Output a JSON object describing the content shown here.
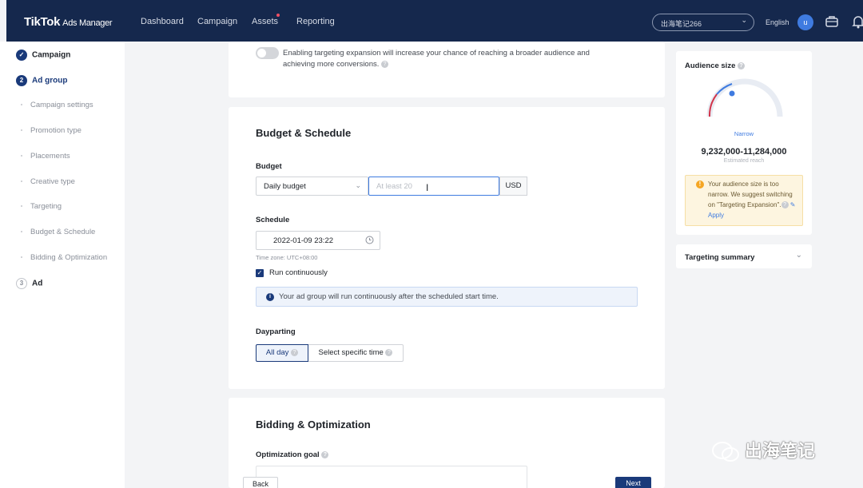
{
  "topbar": {
    "logo": "TikTok",
    "logo_sub": "Ads Manager",
    "nav": [
      "Dashboard",
      "Campaign",
      "Assets",
      "Reporting"
    ],
    "account": "出海笔记266",
    "language": "English",
    "avatar_letter": "u"
  },
  "sidebar": {
    "steps": [
      {
        "label": "Campaign",
        "state": "done"
      },
      {
        "label": "Ad group",
        "number": "2",
        "state": "active"
      },
      {
        "label": "Ad",
        "number": "3",
        "state": "pending"
      }
    ],
    "sub_items": [
      "Campaign settings",
      "Promotion type",
      "Placements",
      "Creative type",
      "Targeting",
      "Budget & Schedule",
      "Bidding & Optimization"
    ]
  },
  "expansion": {
    "text": "Enabling targeting expansion will increase your chance of reaching a broader audience and achieving more conversions."
  },
  "budget_schedule": {
    "title": "Budget & Schedule",
    "budget_label": "Budget",
    "budget_type": "Daily budget",
    "budget_placeholder": "At least 20",
    "currency": "USD",
    "schedule_label": "Schedule",
    "start_time": "2022-01-09 23:22",
    "timezone": "Time zone: UTC+08:00",
    "run_continuously": "Run continuously",
    "info": "Your ad group will run continuously after the scheduled start time.",
    "dayparting_label": "Dayparting",
    "dayparting_options": [
      "All day",
      "Select specific time"
    ]
  },
  "bidding": {
    "title": "Bidding & Optimization",
    "goal_label": "Optimization goal"
  },
  "footer": {
    "back": "Back",
    "next": "Next"
  },
  "audience": {
    "title": "Audience size",
    "gauge_label": "Narrow",
    "reach": "9,232,000-11,284,000",
    "reach_label": "Estimated reach",
    "warning": "Your audience size is too narrow. We suggest switching on \"Targeting Expansion\".",
    "apply": "Apply"
  },
  "targeting_summary": "Targeting summary",
  "watermark": "出海笔记",
  "colors": {
    "topbar": "#15284d",
    "primary": "#1a3a7a",
    "accent_blue": "#3f7be0",
    "warning_bg": "#fdf5e0"
  }
}
